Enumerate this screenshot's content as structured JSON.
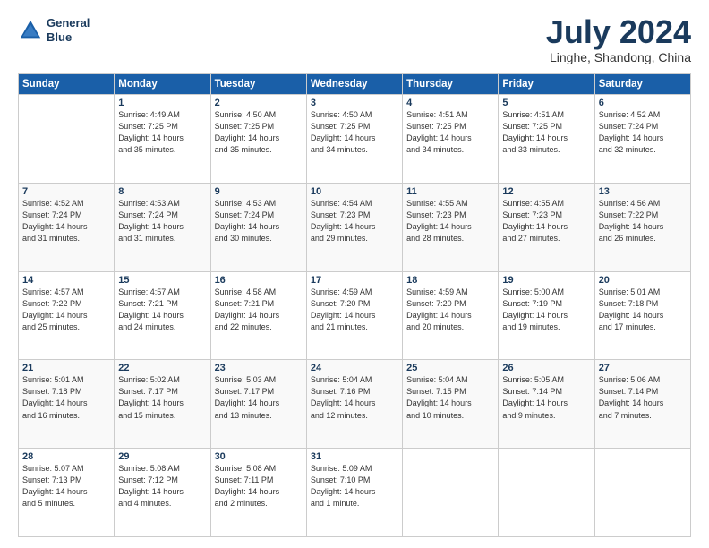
{
  "header": {
    "logo_line1": "General",
    "logo_line2": "Blue",
    "month_year": "July 2024",
    "location": "Linghe, Shandong, China"
  },
  "weekdays": [
    "Sunday",
    "Monday",
    "Tuesday",
    "Wednesday",
    "Thursday",
    "Friday",
    "Saturday"
  ],
  "weeks": [
    [
      {
        "day": "",
        "info": ""
      },
      {
        "day": "1",
        "info": "Sunrise: 4:49 AM\nSunset: 7:25 PM\nDaylight: 14 hours\nand 35 minutes."
      },
      {
        "day": "2",
        "info": "Sunrise: 4:50 AM\nSunset: 7:25 PM\nDaylight: 14 hours\nand 35 minutes."
      },
      {
        "day": "3",
        "info": "Sunrise: 4:50 AM\nSunset: 7:25 PM\nDaylight: 14 hours\nand 34 minutes."
      },
      {
        "day": "4",
        "info": "Sunrise: 4:51 AM\nSunset: 7:25 PM\nDaylight: 14 hours\nand 34 minutes."
      },
      {
        "day": "5",
        "info": "Sunrise: 4:51 AM\nSunset: 7:25 PM\nDaylight: 14 hours\nand 33 minutes."
      },
      {
        "day": "6",
        "info": "Sunrise: 4:52 AM\nSunset: 7:24 PM\nDaylight: 14 hours\nand 32 minutes."
      }
    ],
    [
      {
        "day": "7",
        "info": "Sunrise: 4:52 AM\nSunset: 7:24 PM\nDaylight: 14 hours\nand 31 minutes."
      },
      {
        "day": "8",
        "info": "Sunrise: 4:53 AM\nSunset: 7:24 PM\nDaylight: 14 hours\nand 31 minutes."
      },
      {
        "day": "9",
        "info": "Sunrise: 4:53 AM\nSunset: 7:24 PM\nDaylight: 14 hours\nand 30 minutes."
      },
      {
        "day": "10",
        "info": "Sunrise: 4:54 AM\nSunset: 7:23 PM\nDaylight: 14 hours\nand 29 minutes."
      },
      {
        "day": "11",
        "info": "Sunrise: 4:55 AM\nSunset: 7:23 PM\nDaylight: 14 hours\nand 28 minutes."
      },
      {
        "day": "12",
        "info": "Sunrise: 4:55 AM\nSunset: 7:23 PM\nDaylight: 14 hours\nand 27 minutes."
      },
      {
        "day": "13",
        "info": "Sunrise: 4:56 AM\nSunset: 7:22 PM\nDaylight: 14 hours\nand 26 minutes."
      }
    ],
    [
      {
        "day": "14",
        "info": "Sunrise: 4:57 AM\nSunset: 7:22 PM\nDaylight: 14 hours\nand 25 minutes."
      },
      {
        "day": "15",
        "info": "Sunrise: 4:57 AM\nSunset: 7:21 PM\nDaylight: 14 hours\nand 24 minutes."
      },
      {
        "day": "16",
        "info": "Sunrise: 4:58 AM\nSunset: 7:21 PM\nDaylight: 14 hours\nand 22 minutes."
      },
      {
        "day": "17",
        "info": "Sunrise: 4:59 AM\nSunset: 7:20 PM\nDaylight: 14 hours\nand 21 minutes."
      },
      {
        "day": "18",
        "info": "Sunrise: 4:59 AM\nSunset: 7:20 PM\nDaylight: 14 hours\nand 20 minutes."
      },
      {
        "day": "19",
        "info": "Sunrise: 5:00 AM\nSunset: 7:19 PM\nDaylight: 14 hours\nand 19 minutes."
      },
      {
        "day": "20",
        "info": "Sunrise: 5:01 AM\nSunset: 7:18 PM\nDaylight: 14 hours\nand 17 minutes."
      }
    ],
    [
      {
        "day": "21",
        "info": "Sunrise: 5:01 AM\nSunset: 7:18 PM\nDaylight: 14 hours\nand 16 minutes."
      },
      {
        "day": "22",
        "info": "Sunrise: 5:02 AM\nSunset: 7:17 PM\nDaylight: 14 hours\nand 15 minutes."
      },
      {
        "day": "23",
        "info": "Sunrise: 5:03 AM\nSunset: 7:17 PM\nDaylight: 14 hours\nand 13 minutes."
      },
      {
        "day": "24",
        "info": "Sunrise: 5:04 AM\nSunset: 7:16 PM\nDaylight: 14 hours\nand 12 minutes."
      },
      {
        "day": "25",
        "info": "Sunrise: 5:04 AM\nSunset: 7:15 PM\nDaylight: 14 hours\nand 10 minutes."
      },
      {
        "day": "26",
        "info": "Sunrise: 5:05 AM\nSunset: 7:14 PM\nDaylight: 14 hours\nand 9 minutes."
      },
      {
        "day": "27",
        "info": "Sunrise: 5:06 AM\nSunset: 7:14 PM\nDaylight: 14 hours\nand 7 minutes."
      }
    ],
    [
      {
        "day": "28",
        "info": "Sunrise: 5:07 AM\nSunset: 7:13 PM\nDaylight: 14 hours\nand 5 minutes."
      },
      {
        "day": "29",
        "info": "Sunrise: 5:08 AM\nSunset: 7:12 PM\nDaylight: 14 hours\nand 4 minutes."
      },
      {
        "day": "30",
        "info": "Sunrise: 5:08 AM\nSunset: 7:11 PM\nDaylight: 14 hours\nand 2 minutes."
      },
      {
        "day": "31",
        "info": "Sunrise: 5:09 AM\nSunset: 7:10 PM\nDaylight: 14 hours\nand 1 minute."
      },
      {
        "day": "",
        "info": ""
      },
      {
        "day": "",
        "info": ""
      },
      {
        "day": "",
        "info": ""
      }
    ]
  ]
}
